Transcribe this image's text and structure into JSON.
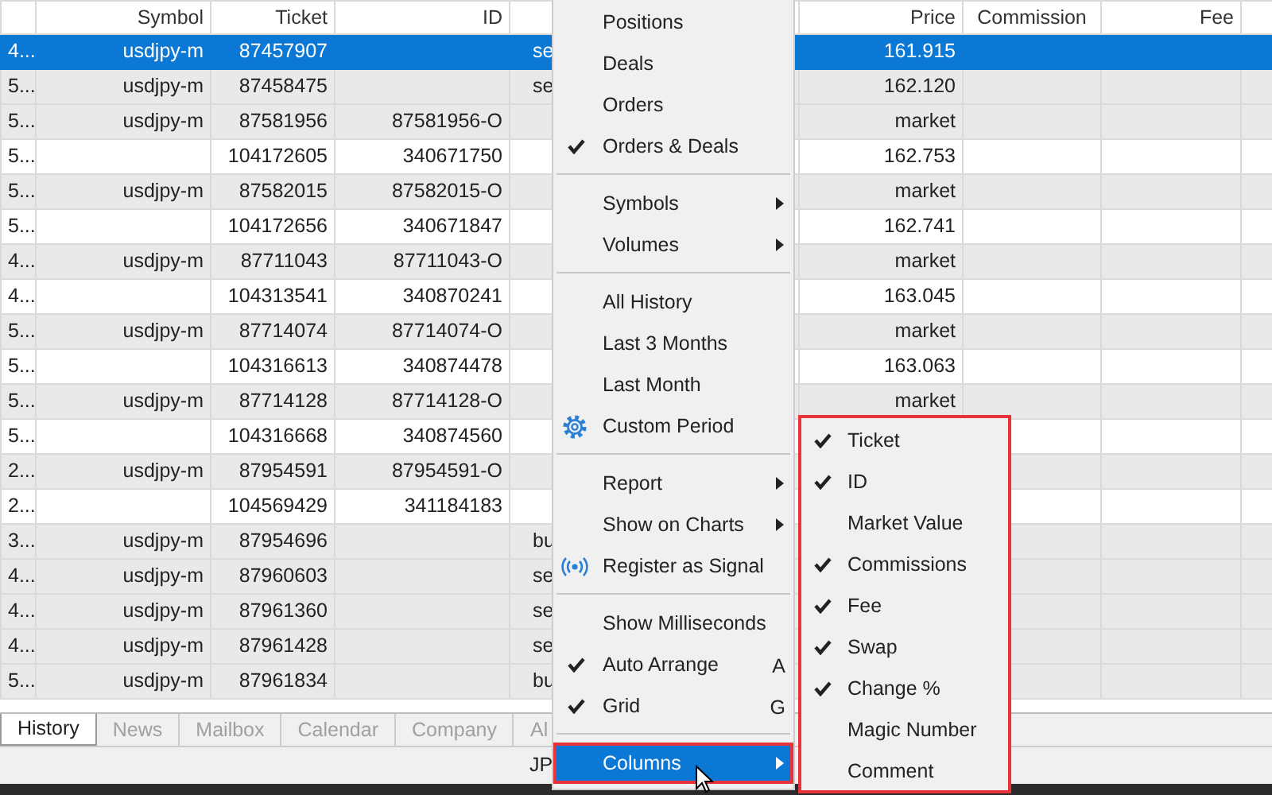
{
  "table": {
    "columns": [
      {},
      {
        "label": "Symbol"
      },
      {
        "label": "Ticket"
      },
      {
        "label": "ID"
      },
      {},
      {
        "label": "Price"
      },
      {
        "label": "Commission"
      },
      {
        "label": "Fee"
      },
      {}
    ],
    "rows": [
      {
        "selected": true,
        "shaded": false,
        "column_1": "4...",
        "symbol": "usdjpy-m",
        "ticket": "87457907",
        "column_5": "se",
        "price": "161.915"
      },
      {
        "selected": false,
        "shaded": true,
        "column_1": "5...",
        "symbol": "usdjpy-m",
        "ticket": "87458475",
        "column_5": "se",
        "price": "162.120"
      },
      {
        "selected": false,
        "shaded": true,
        "column_1": "5...",
        "symbol": "usdjpy-m",
        "ticket": "87581956",
        "id": "87581956-O",
        "price": "market"
      },
      {
        "selected": false,
        "shaded": false,
        "column_1": "5...",
        "ticket": "104172605",
        "id": "340671750",
        "price": "162.753"
      },
      {
        "selected": false,
        "shaded": true,
        "column_1": "5...",
        "symbol": "usdjpy-m",
        "ticket": "87582015",
        "id": "87582015-O",
        "price": "market"
      },
      {
        "selected": false,
        "shaded": false,
        "column_1": "5...",
        "ticket": "104172656",
        "id": "340671847",
        "price": "162.741"
      },
      {
        "selected": false,
        "shaded": true,
        "column_1": "4...",
        "symbol": "usdjpy-m",
        "ticket": "87711043",
        "id": "87711043-O",
        "price": "market"
      },
      {
        "selected": false,
        "shaded": false,
        "column_1": "4...",
        "ticket": "104313541",
        "id": "340870241",
        "price": "163.045"
      },
      {
        "selected": false,
        "shaded": true,
        "column_1": "5...",
        "symbol": "usdjpy-m",
        "ticket": "87714074",
        "id": "87714074-O",
        "price": "market"
      },
      {
        "selected": false,
        "shaded": false,
        "column_1": "5...",
        "ticket": "104316613",
        "id": "340874478",
        "price": "163.063"
      },
      {
        "selected": false,
        "shaded": true,
        "column_1": "5...",
        "symbol": "usdjpy-m",
        "ticket": "87714128",
        "id": "87714128-O",
        "price": "market"
      },
      {
        "selected": false,
        "shaded": false,
        "column_1": "5...",
        "ticket": "104316668",
        "id": "340874560"
      },
      {
        "selected": false,
        "shaded": true,
        "column_1": "2...",
        "symbol": "usdjpy-m",
        "ticket": "87954591",
        "id": "87954591-O"
      },
      {
        "selected": false,
        "shaded": false,
        "column_1": "2...",
        "ticket": "104569429",
        "id": "341184183"
      },
      {
        "selected": false,
        "shaded": true,
        "column_1": "3...",
        "symbol": "usdjpy-m",
        "ticket": "87954696",
        "column_5": "bu"
      },
      {
        "selected": false,
        "shaded": true,
        "column_1": "4...",
        "symbol": "usdjpy-m",
        "ticket": "87960603",
        "column_5": "se"
      },
      {
        "selected": false,
        "shaded": true,
        "column_1": "4...",
        "symbol": "usdjpy-m",
        "ticket": "87961360",
        "column_5": "se"
      },
      {
        "selected": false,
        "shaded": true,
        "column_1": "4...",
        "symbol": "usdjpy-m",
        "ticket": "87961428",
        "column_5": "se"
      },
      {
        "selected": false,
        "shaded": true,
        "column_1": "5...",
        "symbol": "usdjpy-m",
        "ticket": "87961834",
        "column_5": "bu"
      }
    ]
  },
  "tabs": [
    {
      "label": "History",
      "selected": true
    },
    {
      "label": "News",
      "selected": false
    },
    {
      "label": "Mailbox",
      "selected": false
    },
    {
      "label": "Calendar",
      "selected": false
    },
    {
      "label": "Company",
      "selected": false
    },
    {
      "label": "Al",
      "selected": false
    }
  ],
  "status_bar": {
    "text": "JP"
  },
  "context_menu": {
    "items": [
      {
        "kind": "plain",
        "label": "Positions",
        "checked": false,
        "submenu": false,
        "selected": false,
        "highlighted": false
      },
      {
        "kind": "plain",
        "label": "Deals",
        "checked": false,
        "submenu": false,
        "selected": false,
        "highlighted": false
      },
      {
        "kind": "plain",
        "label": "Orders",
        "checked": false,
        "submenu": false,
        "selected": false,
        "highlighted": false
      },
      {
        "kind": "plain",
        "label": "Orders & Deals",
        "checked": true,
        "submenu": false,
        "selected": false,
        "highlighted": false
      },
      {
        "kind": "separator"
      },
      {
        "kind": "plain",
        "label": "Symbols",
        "checked": false,
        "submenu": true,
        "selected": false,
        "highlighted": false
      },
      {
        "kind": "plain",
        "label": "Volumes",
        "checked": false,
        "submenu": true,
        "selected": false,
        "highlighted": false
      },
      {
        "kind": "separator"
      },
      {
        "kind": "plain",
        "label": "All History",
        "checked": false,
        "submenu": false,
        "selected": false,
        "highlighted": false
      },
      {
        "kind": "plain",
        "label": "Last 3 Months",
        "checked": false,
        "submenu": false,
        "selected": false,
        "highlighted": false
      },
      {
        "kind": "plain",
        "label": "Last Month",
        "checked": false,
        "submenu": false,
        "selected": false,
        "highlighted": false
      },
      {
        "kind": "gear",
        "label": "Custom Period",
        "checked": false,
        "submenu": false,
        "selected": false,
        "highlighted": false
      },
      {
        "kind": "separator"
      },
      {
        "kind": "plain",
        "label": "Report",
        "checked": false,
        "submenu": true,
        "selected": false,
        "highlighted": false
      },
      {
        "kind": "plain",
        "label": "Show on Charts",
        "checked": false,
        "submenu": true,
        "selected": false,
        "highlighted": false
      },
      {
        "kind": "signal",
        "label": "Register as Signal",
        "checked": false,
        "submenu": false,
        "selected": false,
        "highlighted": false
      },
      {
        "kind": "separator"
      },
      {
        "kind": "plain",
        "label": "Show Milliseconds",
        "checked": false,
        "submenu": false,
        "selected": false,
        "highlighted": false
      },
      {
        "kind": "plain",
        "label": "Auto Arrange",
        "checked": true,
        "submenu": false,
        "selected": false,
        "highlighted": false,
        "shortcut": "A"
      },
      {
        "kind": "plain",
        "label": "Grid",
        "checked": true,
        "submenu": false,
        "selected": false,
        "highlighted": false,
        "shortcut": "G"
      },
      {
        "kind": "separator"
      },
      {
        "kind": "plain",
        "label": "Columns",
        "checked": false,
        "submenu": true,
        "selected": true,
        "highlighted": true
      }
    ]
  },
  "columns_submenu": {
    "highlighted": true,
    "items": [
      {
        "label": "Ticket",
        "checked": true
      },
      {
        "label": "ID",
        "checked": true
      },
      {
        "label": "Market Value",
        "checked": false
      },
      {
        "label": "Commissions",
        "checked": true
      },
      {
        "label": "Fee",
        "checked": true
      },
      {
        "label": "Swap",
        "checked": true
      },
      {
        "label": "Change %",
        "checked": true
      },
      {
        "label": "Magic Number",
        "checked": false
      },
      {
        "label": "Comment",
        "checked": false
      }
    ]
  }
}
